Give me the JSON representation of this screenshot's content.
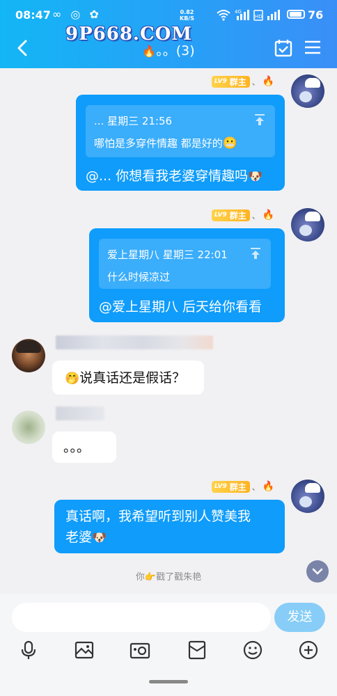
{
  "status_bar": {
    "time": "08:47",
    "left_icons": "∞ ◎ ✿",
    "net_speed_value": "0.82",
    "net_speed_unit": "KB/S",
    "signal_label": "4G HD",
    "battery": "76"
  },
  "header": {
    "watermark": "9P668.COM",
    "title_fire": "🔥",
    "title_dots": "。。",
    "title_count": "(3)"
  },
  "messages": [
    {
      "sender": "me",
      "level": "LV9",
      "role": "群主",
      "separator": "、",
      "quote_head": "... 星期三 21:56",
      "quote_body": "哪怕是多穿件情趣 都是好的",
      "text": "@... 你想看我老婆穿情趣吗"
    },
    {
      "sender": "me",
      "level": "LV9",
      "role": "群主",
      "separator": "、",
      "quote_head": "爱上星期八 星期三 22:01",
      "quote_body": "什么时候凉过",
      "text": "@爱上星期八 后天给你看看"
    },
    {
      "sender": "other",
      "text": "说真话还是假话？"
    },
    {
      "sender": "other",
      "text": "。。。"
    },
    {
      "sender": "me",
      "level": "LV9",
      "role": "群主",
      "separator": "、",
      "text_line1": "真话啊，我希望听到别人赞美我",
      "text_line2": "老婆"
    }
  ],
  "poke": {
    "prefix": "你",
    "action": "戳了戳朱艳"
  },
  "input": {
    "placeholder": "",
    "send_label": "发送"
  },
  "colors": {
    "header_start": "#13b6f5",
    "header_end": "#3a8ff7",
    "bubble_blue": "#0f9cfb",
    "send_button": "#87cdf8"
  }
}
